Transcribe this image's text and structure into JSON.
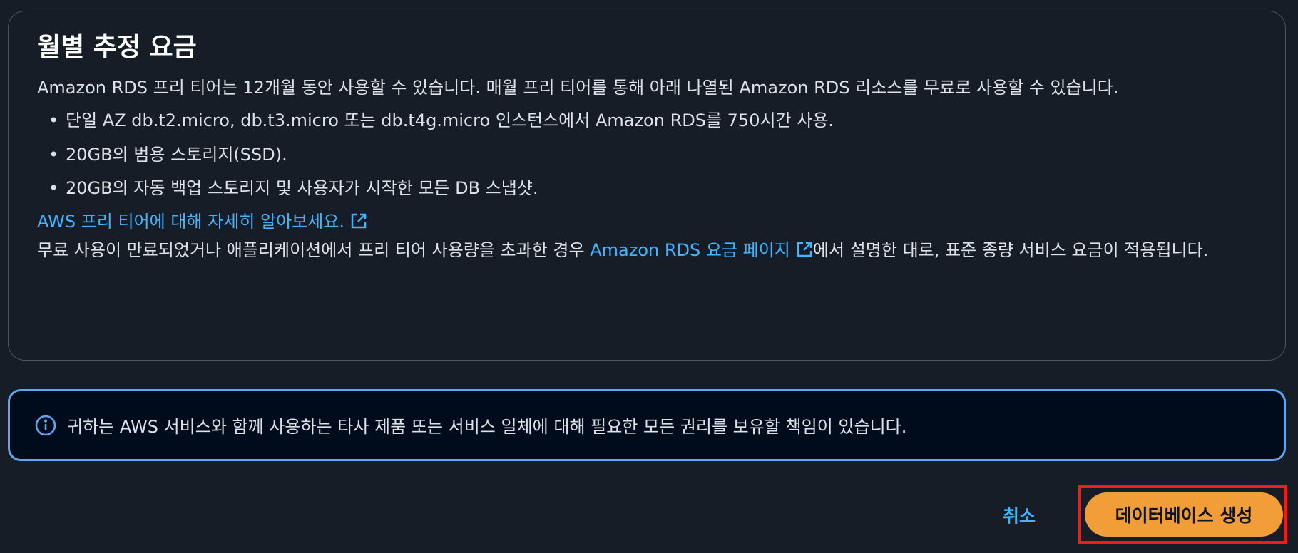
{
  "panel": {
    "title": "월별 추정 요금",
    "intro": "Amazon RDS 프리 티어는 12개월 동안 사용할 수 있습니다. 매월 프리 티어를 통해 아래 나열된 Amazon RDS 리소스를 무료로 사용할 수 있습니다.",
    "bullets": [
      "단일 AZ db.t2.micro, db.t3.micro 또는 db.t4g.micro 인스턴스에서 Amazon RDS를 750시간 사용.",
      "20GB의 범용 스토리지(SSD).",
      "20GB의 자동 백업 스토리지 및 사용자가 시작한 모든 DB 스냅샷."
    ],
    "learn_more_link": "AWS 프리 티어에 대해 자세히 알아보세요.",
    "note_before": "무료 사용이 만료되었거나 애플리케이션에서 프리 티어 사용량을 초과한 경우 ",
    "note_link": "Amazon RDS 요금 페이지",
    "note_after": "에서 설명한 대로, 표준 종량 서비스 요금이 적용됩니다."
  },
  "alert": {
    "text": "귀하는 AWS 서비스와 함께 사용하는 타사 제품 또는 서비스 일체에 대해 필요한 모든 권리를 보유할 책임이 있습니다."
  },
  "actions": {
    "cancel_label": "취소",
    "create_label": "데이터베이스 생성"
  },
  "colors": {
    "background": "#161d26",
    "link": "#42b4ff",
    "primary_button": "#f19e38",
    "alert_border": "#5fa6f0",
    "highlight_border": "#e8201c"
  },
  "icons": [
    "external-link-icon",
    "info-icon"
  ]
}
